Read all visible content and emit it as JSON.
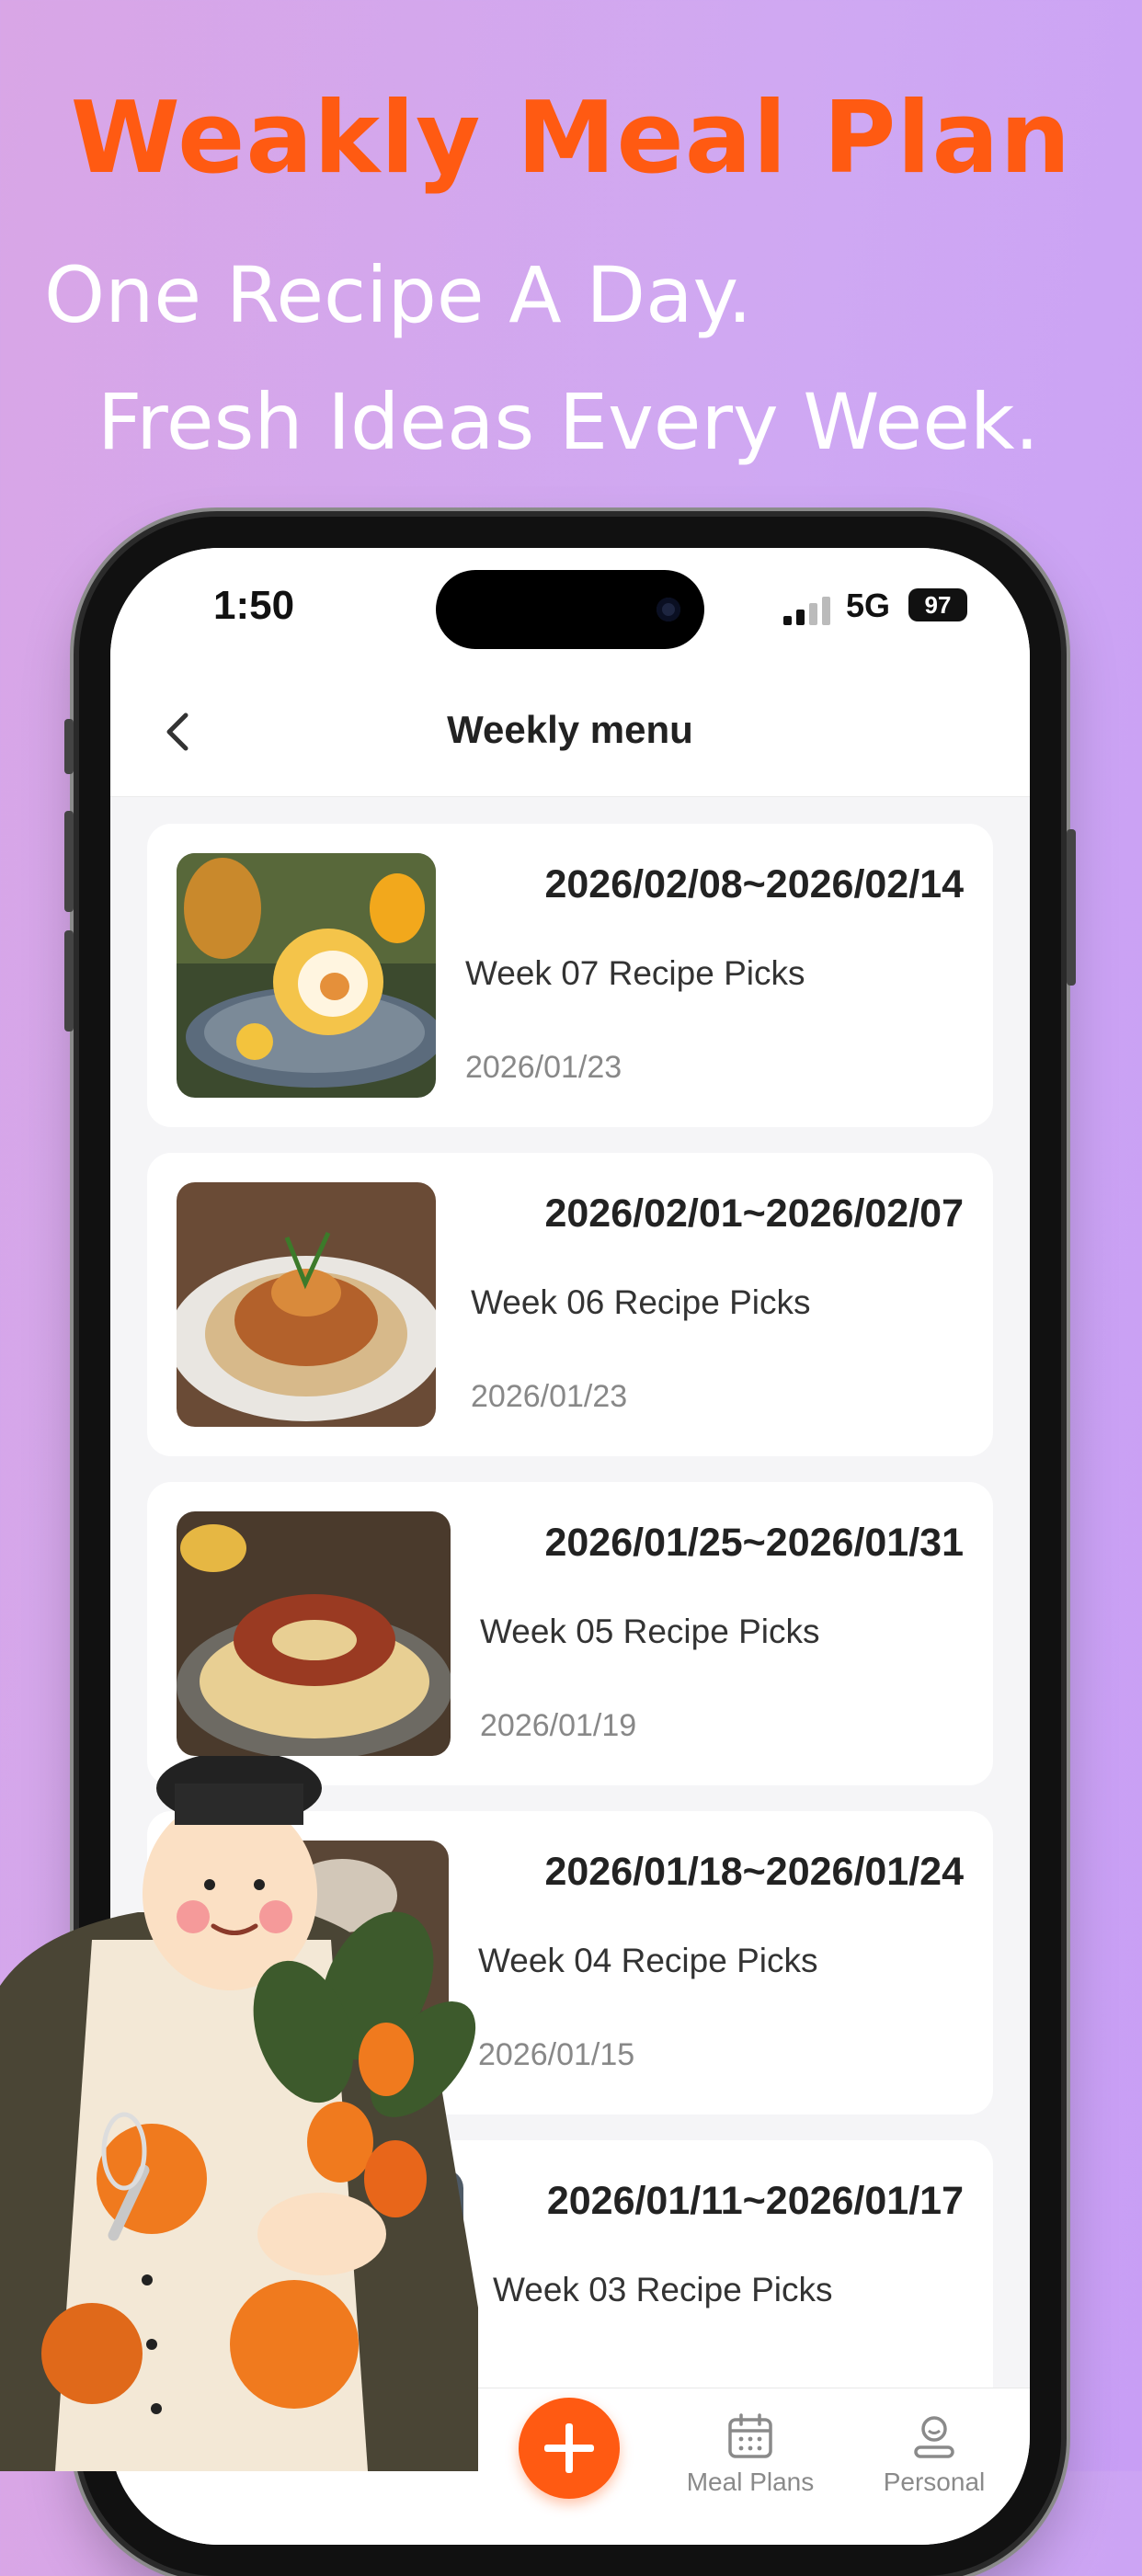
{
  "promo": {
    "headline": "Weakly Meal Plan",
    "line1": "One Recipe A Day.",
    "line2": "Fresh Ideas Every Week."
  },
  "status": {
    "time": "1:50",
    "network": "5G",
    "battery": "97"
  },
  "nav": {
    "title": "Weekly menu"
  },
  "weeks": [
    {
      "range": "2026/02/08~2026/02/14",
      "picks": "Week 07 Recipe Picks",
      "date": "2026/01/23",
      "image": "mango-swiss-roll"
    },
    {
      "range": "2026/02/01~2026/02/07",
      "picks": "Week 06 Recipe Picks",
      "date": "2026/01/23",
      "image": "noodles"
    },
    {
      "range": "2026/01/25~2026/01/31",
      "picks": "Week 05 Recipe Picks",
      "date": "2026/01/19",
      "image": "sausage-sauerkraut"
    },
    {
      "range": "2026/01/18~2026/01/24",
      "picks": "Week 04 Recipe Picks",
      "date": "2026/01/15",
      "image": "dish"
    },
    {
      "range": "2026/01/11~2026/01/17",
      "picks": "Week 03 Recipe Picks",
      "date": "",
      "image": "dish"
    }
  ],
  "tabs": {
    "add_icon": "plus-icon",
    "meal_plans": "Meal Plans",
    "personal": "Personal"
  },
  "colors": {
    "accent": "#ff5a12",
    "background": "#cfa8f3"
  }
}
